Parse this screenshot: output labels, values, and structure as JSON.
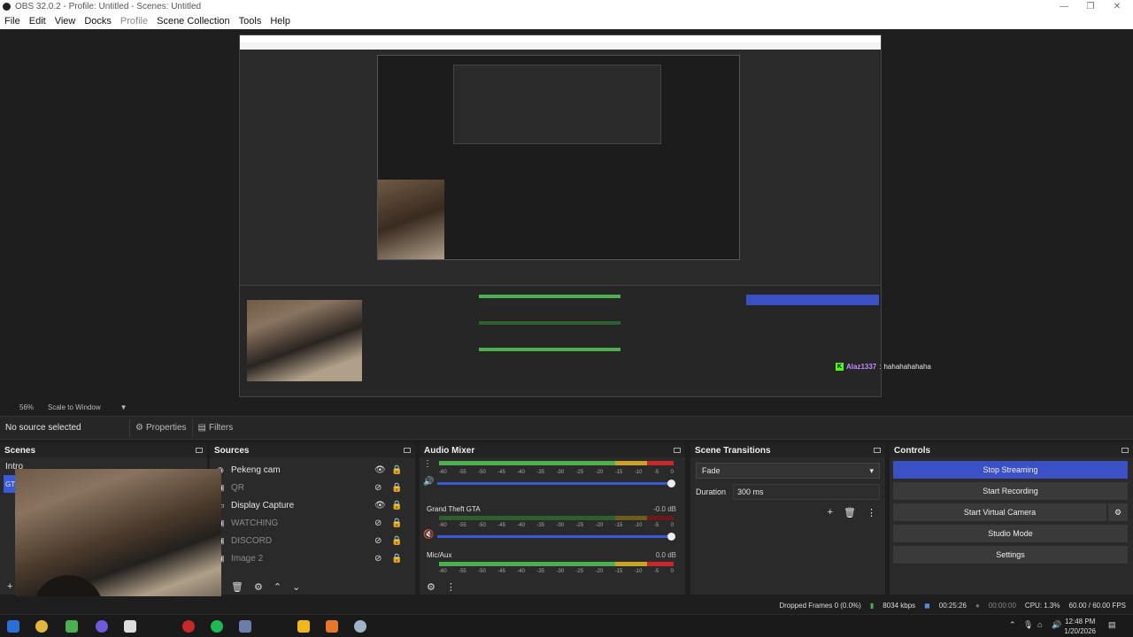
{
  "window": {
    "title": "OBS 32.0.2 - Profile: Untitled - Scenes: Untitled"
  },
  "menu": [
    "File",
    "Edit",
    "View",
    "Docks",
    "Profile",
    "Scene Collection",
    "Tools",
    "Help"
  ],
  "preview": {
    "scale_pct": "56%",
    "scale_mode": "Scale to Window",
    "chat": {
      "user": "Alaz1337",
      "sep": ":",
      "message": "hahahahahaha"
    }
  },
  "sourcebar": {
    "no_source": "No source selected",
    "properties": "Properties",
    "filters": "Filters"
  },
  "scenes": {
    "title": "Scenes",
    "items": [
      {
        "label": "Intro"
      },
      {
        "label": "GT"
      }
    ]
  },
  "sources": {
    "title": "Sources",
    "items": [
      {
        "label": "Pekeng cam",
        "visible": true
      },
      {
        "label": "QR",
        "visible": false
      },
      {
        "label": "Display Capture",
        "visible": true
      },
      {
        "label": "WATCHING",
        "visible": false
      },
      {
        "label": "DISCORD",
        "visible": false
      },
      {
        "label": "Image 2",
        "visible": false
      }
    ]
  },
  "mixer": {
    "title": "Audio Mixer",
    "ticks": [
      "-60",
      "-55",
      "-50",
      "-45",
      "-40",
      "-35",
      "-30",
      "-25",
      "-20",
      "-15",
      "-10",
      "-5",
      "0"
    ],
    "channels": [
      {
        "name": "",
        "db": ""
      },
      {
        "name": "Grand Theft GTA",
        "db": "-0.0 dB"
      },
      {
        "name": "Mic/Aux",
        "db": "0.0 dB"
      }
    ]
  },
  "transitions": {
    "title": "Scene Transitions",
    "type": "Fade",
    "duration_label": "Duration",
    "duration": "300 ms"
  },
  "controls": {
    "title": "Controls",
    "stop_streaming": "Stop Streaming",
    "start_recording": "Start Recording",
    "start_virtual_camera": "Start Virtual Camera",
    "studio_mode": "Studio Mode",
    "settings": "Settings"
  },
  "status": {
    "dropped": "Dropped Frames 0 (0.0%)",
    "bitrate": "8034 kbps",
    "stream_time": "00:25:26",
    "rec_time": "00:00:00",
    "cpu": "CPU: 1.3%",
    "fps": "60.00 / 60.00 FPS"
  },
  "taskbar": {
    "time": "12:48 PM",
    "date": "1/20/2026"
  },
  "colors": {
    "accent": "#3b50c4",
    "kick_green": "#53fc18"
  }
}
